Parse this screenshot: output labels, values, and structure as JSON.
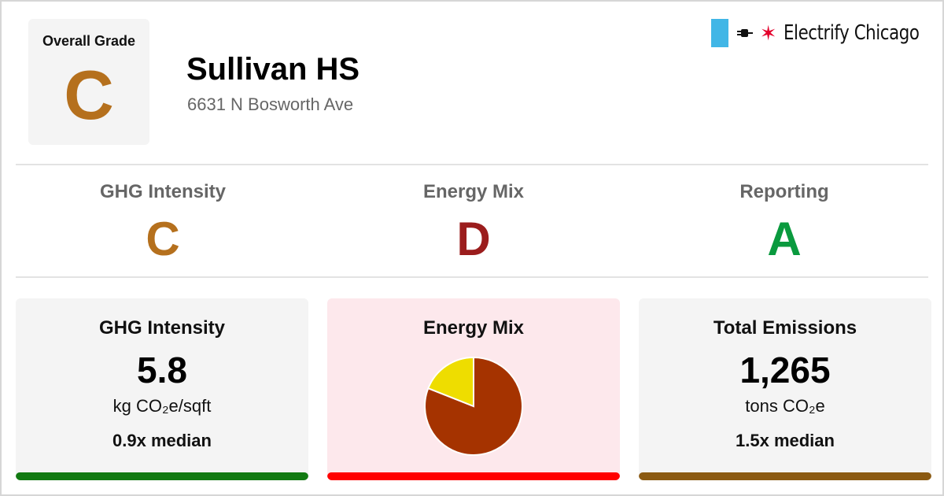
{
  "header": {
    "overall_grade_label": "Overall Grade",
    "overall_grade": "C",
    "building_name": "Sullivan HS",
    "address": "6631 N Bosworth Ave"
  },
  "logo": {
    "text": "Electrify Chicago",
    "flag_color": "#41b6e6",
    "star_color": "#e4002b",
    "icons": [
      "chicago-flag-icon",
      "plug-icon",
      "star-icon"
    ]
  },
  "subgrades": [
    {
      "title": "GHG Intensity",
      "grade": "C",
      "color": "#b5701d"
    },
    {
      "title": "Energy Mix",
      "grade": "D",
      "color": "#9b1d1d"
    },
    {
      "title": "Reporting",
      "grade": "A",
      "color": "#0a9a3e"
    }
  ],
  "cards": {
    "ghg": {
      "title": "GHG Intensity",
      "value": "5.8",
      "unit": "kg CO₂e/sqft",
      "median": "0.9x median",
      "bar_color": "#127a12"
    },
    "energy_mix": {
      "title": "Energy Mix",
      "bar_color": "#ff0000",
      "background": "#fde8ec"
    },
    "emissions": {
      "title": "Total Emissions",
      "value": "1,265",
      "unit": "tons CO₂e",
      "median": "1.5x median",
      "bar_color": "#8b5a12"
    }
  },
  "colors": {
    "overall_grade": "#b5701d"
  },
  "chart_data": {
    "type": "pie",
    "title": "",
    "slices": [
      {
        "value": 0.81,
        "color": "#a53300"
      },
      {
        "value": 0.19,
        "color": "#eedd00"
      }
    ]
  }
}
